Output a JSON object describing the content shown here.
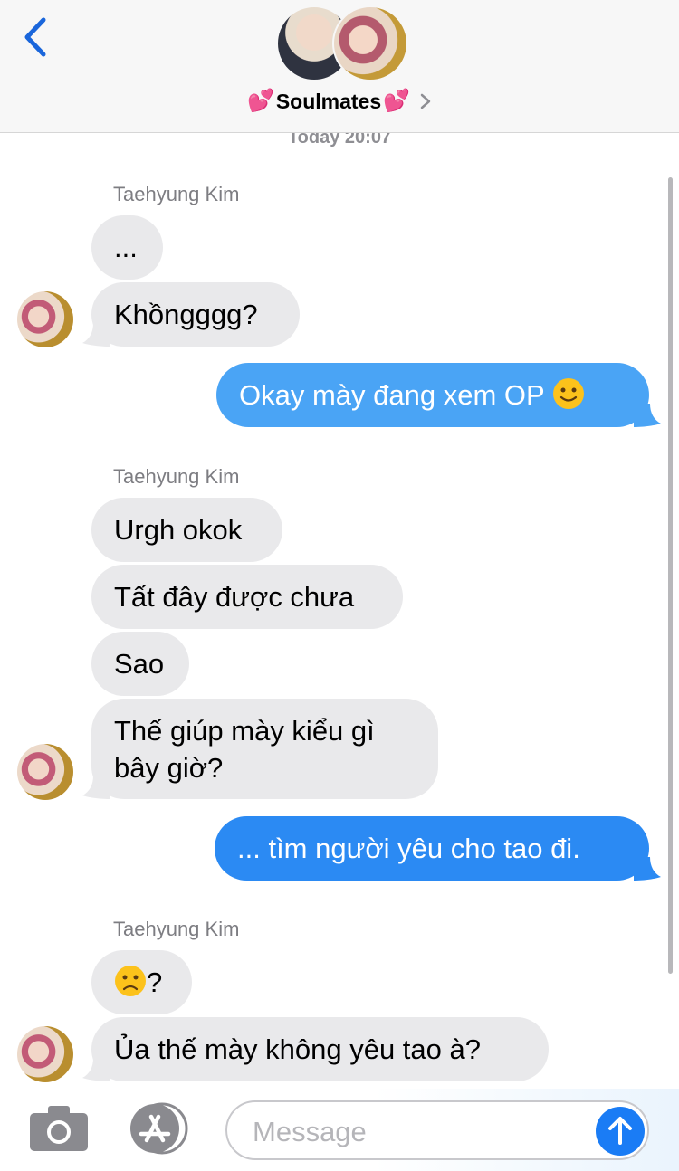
{
  "header": {
    "title": "Soulmates",
    "title_prefix": "💕",
    "title_suffix": "💕",
    "back_icon": "chevron-left-icon",
    "accent": "#1a73e8"
  },
  "timestamp": "Today 20:07",
  "thread": [
    {
      "type": "sender",
      "text": "Taehyung Kim"
    },
    {
      "type": "in",
      "text": "..."
    },
    {
      "type": "in",
      "text": "Khồngggg?"
    },
    {
      "type": "out",
      "text": "Okay mày đang xem OP",
      "emoji": "slight-smile"
    },
    {
      "type": "sender",
      "text": "Taehyung Kim"
    },
    {
      "type": "in",
      "text": "Urgh okok"
    },
    {
      "type": "in",
      "text": "Tất đây được chưa"
    },
    {
      "type": "in",
      "text": "Sao"
    },
    {
      "type": "in",
      "line1": "Thế giúp mày kiểu gì",
      "line2": "bây giờ?"
    },
    {
      "type": "out",
      "text": "... tìm người yêu cho tao đi."
    },
    {
      "type": "sender",
      "text": "Taehyung Kim"
    },
    {
      "type": "in",
      "emoji": "slight-frown",
      "text": "?"
    },
    {
      "type": "in",
      "text": "Ủa thế mày không yêu tao à?"
    }
  ],
  "composer": {
    "placeholder": "Message",
    "camera_icon": "camera-icon",
    "appstore_icon": "app-store-icon",
    "send_icon": "arrow-up-icon"
  },
  "colors": {
    "incoming_bubble": "#e9e9eb",
    "outgoing_bubble": "#4aa4f5",
    "outgoing_bubble_dark": "#2b8af3",
    "send_button": "#1a7cf5"
  }
}
